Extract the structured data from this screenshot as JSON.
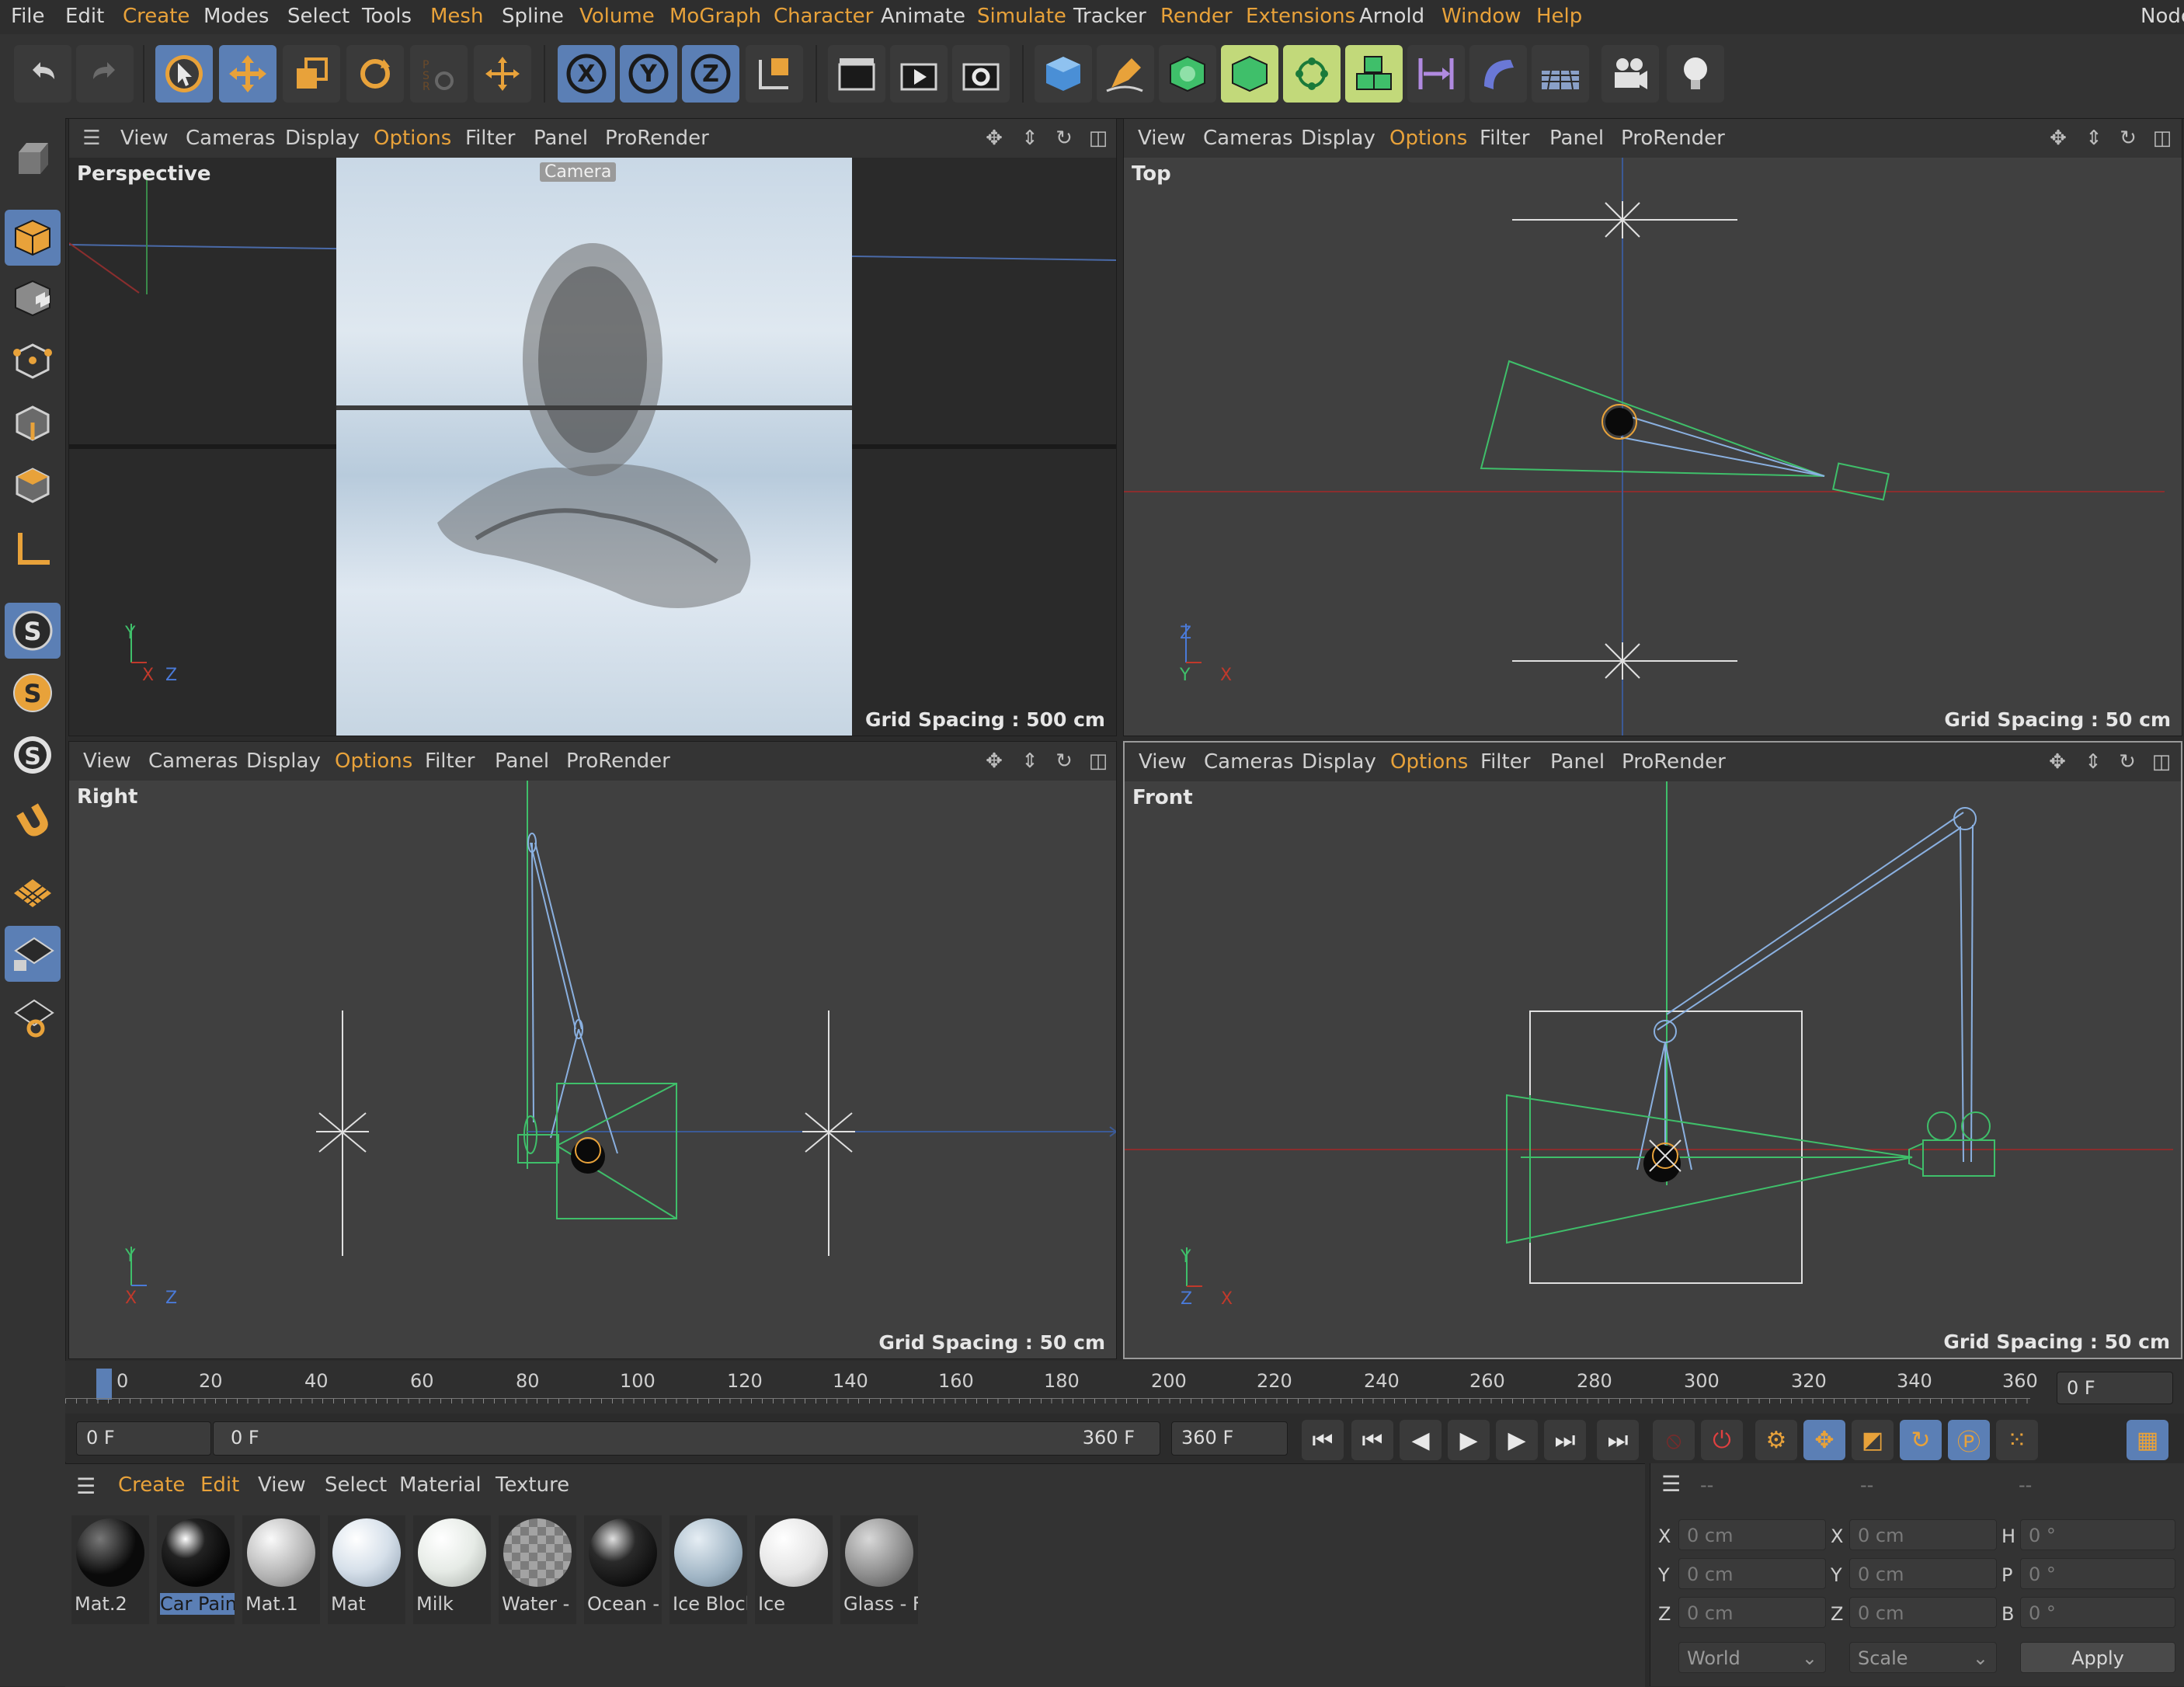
{
  "menu": {
    "items": [
      "File",
      "Edit",
      "Create",
      "Modes",
      "Select",
      "Tools",
      "Mesh",
      "Spline",
      "Volume",
      "MoGraph",
      "Character",
      "Animate",
      "Simulate",
      "Tracker",
      "Render",
      "Extensions",
      "Arnold",
      "Window",
      "Help"
    ],
    "right_label": "Node"
  },
  "toolbar": {
    "icons": [
      "undo-icon",
      "redo-icon",
      "select-arrow-icon",
      "move-icon",
      "scale-icon",
      "rotate-icon",
      "psr-icon",
      "coordinate-move-icon",
      "x-axis-icon",
      "y-axis-icon",
      "z-axis-icon",
      "world-coordinate-icon",
      "render-region-icon",
      "render-view-icon",
      "render-settings-icon",
      "cube-icon",
      "pen-icon",
      "subdivision-icon",
      "extrude-icon",
      "cloner-icon",
      "mograph-icon",
      "symmetry-icon",
      "deformer-icon",
      "floor-icon",
      "camera-icon",
      "light-icon"
    ]
  },
  "viewport_menu": [
    "View",
    "Cameras",
    "Display",
    "Options",
    "Filter",
    "Panel",
    "ProRender"
  ],
  "viewports": {
    "perspective": {
      "name": "Perspective",
      "grid": "Grid Spacing : 500 cm",
      "camera_label": "Camera"
    },
    "top": {
      "name": "Top",
      "grid": "Grid Spacing : 50 cm"
    },
    "right": {
      "name": "Right",
      "grid": "Grid Spacing : 50 cm"
    },
    "front": {
      "name": "Front",
      "grid": "Grid Spacing : 50 cm"
    }
  },
  "axes": {
    "x": "X",
    "y": "Y",
    "z": "Z"
  },
  "timeline": {
    "ticks": [
      "0",
      "20",
      "40",
      "60",
      "80",
      "100",
      "120",
      "140",
      "160",
      "180",
      "200",
      "220",
      "240",
      "260",
      "280",
      "300",
      "320",
      "340",
      "360"
    ],
    "current_frame": "0 F",
    "start_field": "0 F",
    "range_start": "0 F",
    "range_end": "360 F",
    "end_field": "360 F"
  },
  "materials": {
    "menu": [
      "Create",
      "Edit",
      "View",
      "Select",
      "Material",
      "Texture"
    ],
    "items": [
      {
        "name": "Mat.2",
        "color": "#0a0a0a"
      },
      {
        "name": "Car Paint",
        "color": "#111111"
      },
      {
        "name": "Mat.1",
        "color": "#c8c8c8"
      },
      {
        "name": "Mat",
        "color": "#dfe5ea"
      },
      {
        "name": "Milk",
        "color": "#e6eae6"
      },
      {
        "name": "Water - I",
        "color": "#a8a8a8"
      },
      {
        "name": "Ocean -",
        "color": "#1a1a1a"
      },
      {
        "name": "Ice Block",
        "color": "#a9bccb"
      },
      {
        "name": "Ice",
        "color": "#e8e8e8"
      },
      {
        "name": "Glass - F",
        "color": "#9a9a9a"
      }
    ]
  },
  "attributes": {
    "header": [
      "--",
      "--",
      "--"
    ],
    "rows": [
      {
        "l1": "X",
        "v1": "0 cm",
        "l2": "X",
        "v2": "0 cm",
        "l3": "H",
        "v3": "0 °"
      },
      {
        "l1": "Y",
        "v1": "0 cm",
        "l2": "Y",
        "v2": "0 cm",
        "l3": "P",
        "v3": "0 °"
      },
      {
        "l1": "Z",
        "v1": "0 cm",
        "l2": "Z",
        "v2": "0 cm",
        "l3": "B",
        "v3": "0 °"
      }
    ],
    "world_select": "World",
    "scale_select": "Scale",
    "apply_label": "Apply"
  },
  "colors": {
    "accent": "#e8a23a",
    "highlight": "#5b7fb5",
    "viewport_bg": "#404040"
  }
}
